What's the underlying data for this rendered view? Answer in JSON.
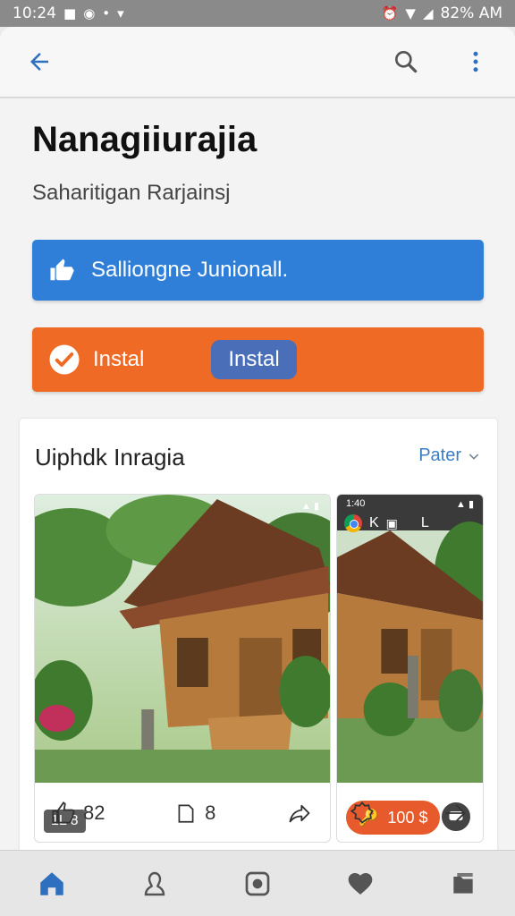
{
  "status_bar": {
    "time": "10:24",
    "left_icons": [
      "9",
      "▪",
      "▾"
    ],
    "battery_text": "82% AM"
  },
  "app_bar": {
    "back_icon": "arrow-left",
    "search_icon": "search",
    "menu_icon": "more-vert",
    "accent": "#2f6fbf"
  },
  "header": {
    "title": "Nanagiiurajia",
    "subtitle": "Saharitigan Rarjainsj"
  },
  "banner_blue": {
    "label": "Salliongne Junionall.",
    "icon": "thumbs-up",
    "color": "#2f7fd8"
  },
  "banner_orange": {
    "label": "Instal",
    "button_label": "Instal",
    "icon": "check-circle",
    "color": "#ee6a25"
  },
  "gallery": {
    "title": "Uiphdk Inragia",
    "filter_label": "Pater",
    "cards": [
      {
        "badge": "1L 8",
        "like_count": "82",
        "comment_count": "8",
        "actions": [
          "like",
          "comment",
          "share"
        ]
      },
      {
        "mini_status_time": "1:40",
        "price": "100 $",
        "actions": [
          "badge",
          "next"
        ]
      }
    ]
  },
  "bottom_nav": {
    "items": [
      "home",
      "profile",
      "camera",
      "favorites",
      "library"
    ],
    "active": "home"
  }
}
